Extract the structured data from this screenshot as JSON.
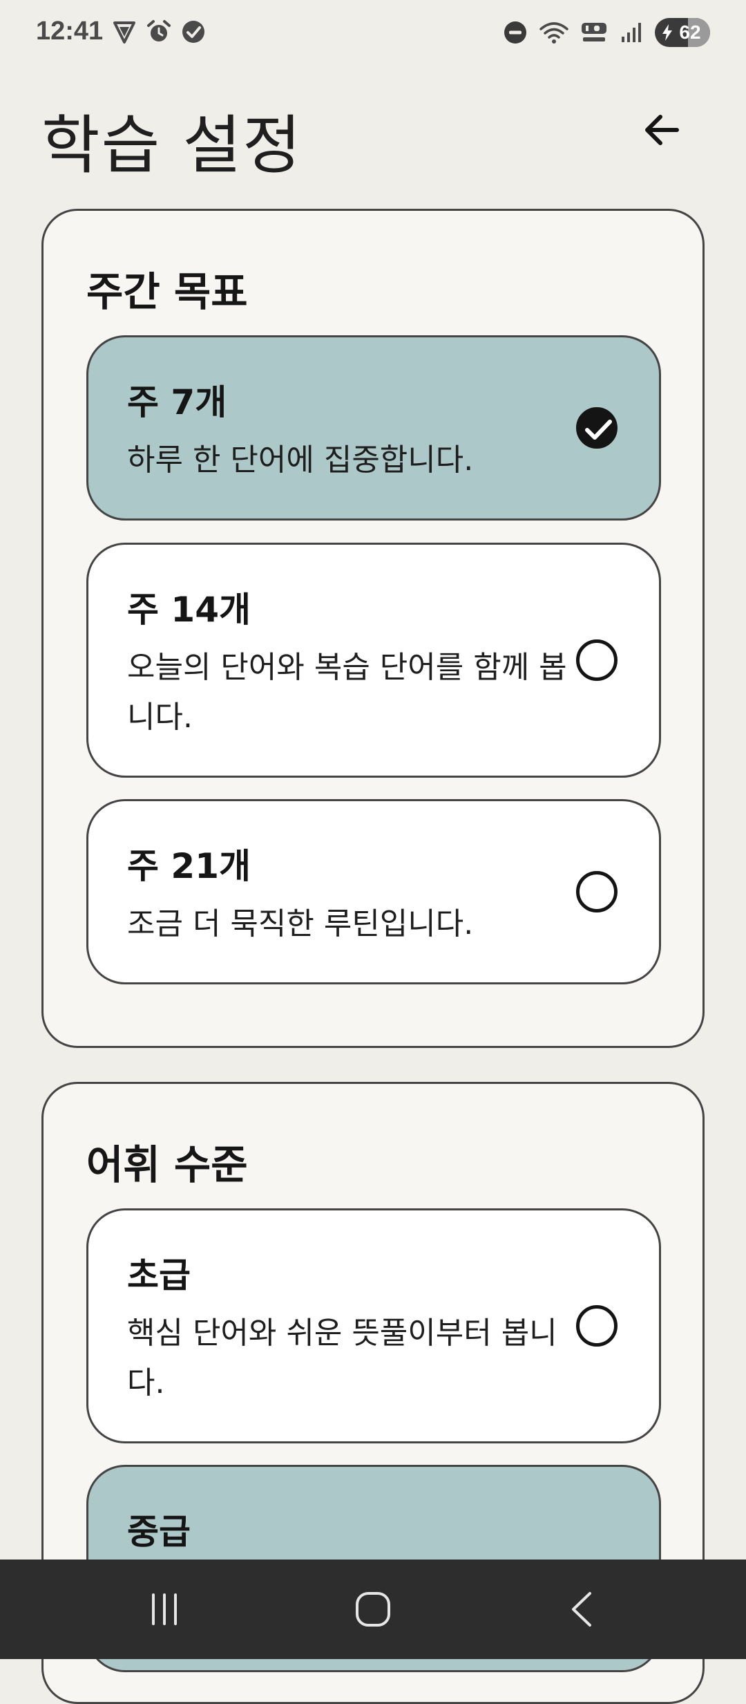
{
  "status_bar": {
    "time": "12:41",
    "battery_level": "62",
    "left_icons": [
      "vpn-shield-icon",
      "alarm-icon",
      "check-badge-icon"
    ],
    "right_icons": [
      "do-not-disturb-icon",
      "wifi-icon",
      "hd-voice-icon",
      "signal-icon",
      "battery-icon"
    ]
  },
  "header": {
    "title": "학습 설정",
    "back_icon": "arrow-left-icon"
  },
  "weekly_goal": {
    "title": "주간 목표",
    "options": [
      {
        "label": "주 7개",
        "description": "하루 한 단어에 집중합니다.",
        "selected": true
      },
      {
        "label": "주 14개",
        "description": "오늘의 단어와 복습 단어를 함께 봅니다.",
        "selected": false
      },
      {
        "label": "주 21개",
        "description": "조금 더 묵직한 루틴입니다.",
        "selected": false
      }
    ]
  },
  "vocab_level": {
    "title": "어휘 수준",
    "options": [
      {
        "label": "초급",
        "description": "핵심 단어와 쉬운 뜻풀이부터 봅니다.",
        "selected": false
      },
      {
        "label": "중급",
        "description": "",
        "selected": true
      }
    ]
  },
  "colors": {
    "background": "#f0eee9",
    "card": "#f8f6f3",
    "selected_option": "#adc8c8",
    "border": "#444444",
    "nav_bar": "#2d2d2d"
  },
  "nav_bar": {
    "icons": [
      "recent-apps-icon",
      "home-icon",
      "back-icon"
    ]
  }
}
